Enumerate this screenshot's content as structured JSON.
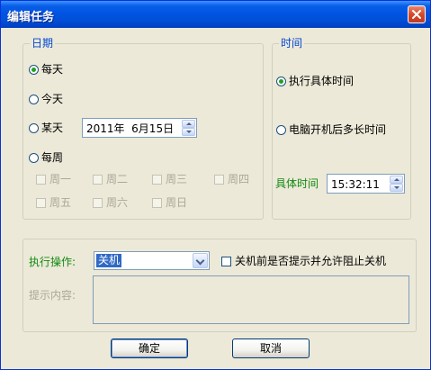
{
  "window": {
    "title": "编辑任务",
    "close_icon": "close-icon"
  },
  "date_group": {
    "legend": "日期",
    "options": [
      {
        "label": "每天",
        "selected": true
      },
      {
        "label": "今天",
        "selected": false
      },
      {
        "label": "某天",
        "selected": false
      },
      {
        "label": "每周",
        "selected": false
      }
    ],
    "date_value": "2011年  6月15日",
    "weekdays": [
      "周一",
      "周二",
      "周三",
      "周四",
      "周五",
      "周六",
      "周日"
    ]
  },
  "time_group": {
    "legend": "时间",
    "options": [
      {
        "label": "执行具体时间",
        "selected": true
      },
      {
        "label": "电脑开机后多长时间",
        "selected": false
      }
    ],
    "specific_time_label": "具体时间",
    "time_value": "15:32:11"
  },
  "action_group": {
    "action_label": "执行操作:",
    "action_value": "关机",
    "prompt_checkbox_label": "关机前是否提示并允许阻止关机",
    "prompt_checked": false,
    "prompt_content_label": "提示内容:"
  },
  "buttons": {
    "ok": "确定",
    "cancel": "取消"
  },
  "colors": {
    "accent_green": "#138a13",
    "legend_blue": "#0046d5",
    "title_blue": "#0054e3"
  }
}
